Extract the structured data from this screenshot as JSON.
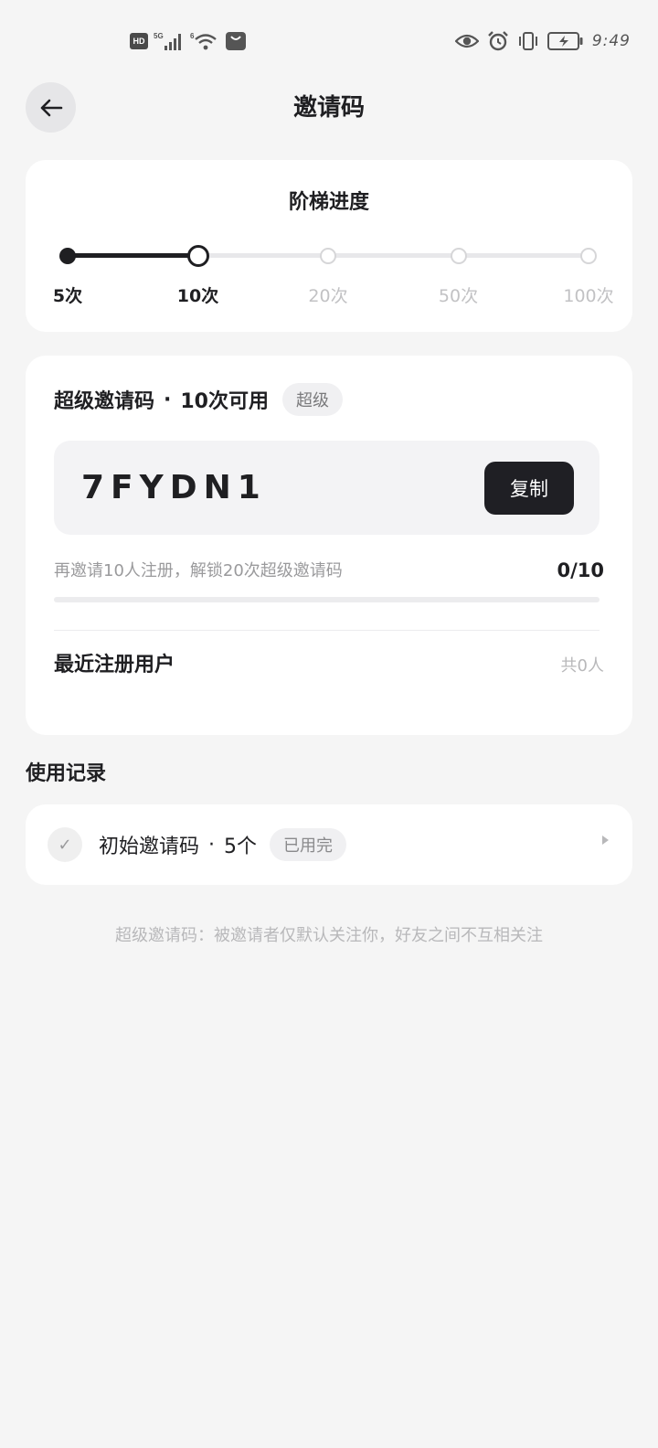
{
  "status_bar": {
    "left_icons": [
      "hd-icon",
      "5g-signal-icon",
      "wifi-icon",
      "shopping-bag-icon"
    ],
    "network_label": "5G",
    "wifi_label": "6",
    "hd_label": "HD",
    "right_icons": [
      "eye-icon",
      "alarm-icon",
      "vibrate-icon",
      "battery-charging-icon"
    ],
    "time": "9:49"
  },
  "header": {
    "title": "邀请码",
    "back_icon": "arrow-left-icon"
  },
  "ladder": {
    "title": "阶梯进度",
    "progress_fraction": 0.25,
    "steps": [
      {
        "label": "5次",
        "state": "done"
      },
      {
        "label": "10次",
        "state": "current"
      },
      {
        "label": "20次",
        "state": "future"
      },
      {
        "label": "50次",
        "state": "future"
      },
      {
        "label": "100次",
        "state": "future"
      }
    ]
  },
  "code_card": {
    "title": "超级邀请码",
    "separator": "·",
    "available": "10次可用",
    "tag": "超级",
    "code": "7FYDN1",
    "copy_label": "复制",
    "unlock_text": "再邀请10人注册，解锁20次超级邀请码",
    "unlock_count": "0/10",
    "unlock_fraction": 0,
    "recent_label": "最近注册用户",
    "recent_count": "共0人"
  },
  "records": {
    "title": "使用记录",
    "items": [
      {
        "check_icon": "check-icon",
        "check_glyph": "✓",
        "name": "初始邀请码",
        "separator": "·",
        "qty": "5个",
        "status": "已用完"
      }
    ]
  },
  "footer_note": "超级邀请码：被邀请者仅默认关注你，好友之间不互相关注",
  "colors": {
    "background": "#f5f5f5",
    "card": "#ffffff",
    "primary": "#1f1f22",
    "muted": "#b8b8ba"
  }
}
